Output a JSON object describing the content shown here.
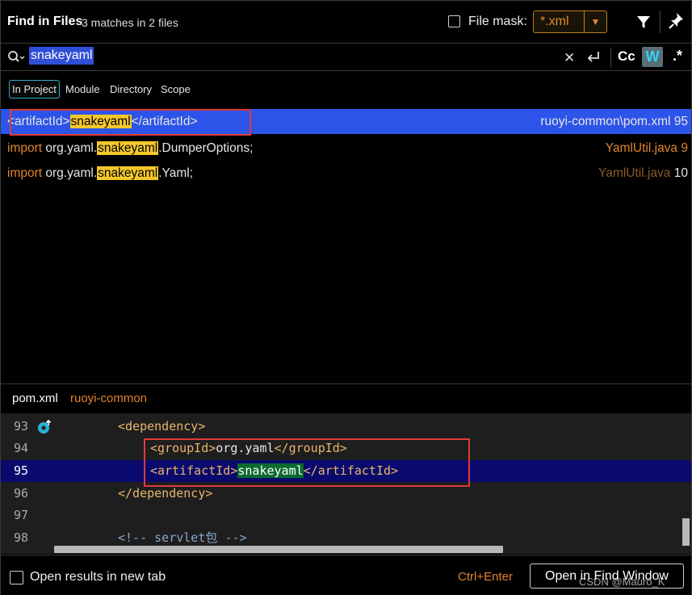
{
  "header": {
    "title": "Find in Files",
    "match_count": "3 matches in 2 files",
    "file_mask_label": "File mask:",
    "file_mask_value": "*.xml"
  },
  "search": {
    "query": "snakeyaml",
    "cc_label": "Cc",
    "words_label": "W",
    "regex_label": ".*"
  },
  "scope": {
    "tabs": [
      "In Project",
      "Module",
      "Directory",
      "Scope"
    ],
    "active": "In Project"
  },
  "results": [
    {
      "prefix": "<artifactId>",
      "match": "snakeyaml",
      "suffix": "</artifactId>",
      "location": "ruoyi-common\\pom.xml 95"
    },
    {
      "keyword": "import",
      "prefix": " org.yaml.",
      "match": "snakeyaml",
      "suffix": ".DumperOptions;",
      "file": "YamlUtil.java",
      "line": "9"
    },
    {
      "keyword": "import",
      "prefix": " org.yaml.",
      "match": "snakeyaml",
      "suffix": ".Yaml;",
      "file": "YamlUtil.java",
      "line": "10"
    }
  ],
  "preview": {
    "file": "pom.xml",
    "module": "ruoyi-common",
    "lines": [
      {
        "num": "93",
        "open": "<dependency>"
      },
      {
        "num": "94",
        "open": "<groupId>",
        "text": "org.yaml",
        "close": "</groupId>"
      },
      {
        "num": "95",
        "open": "<artifactId>",
        "text": "snakeyaml",
        "close": "</artifactId>"
      },
      {
        "num": "96",
        "open": "</dependency>"
      },
      {
        "num": "97"
      },
      {
        "num": "98",
        "comment": "<!-- servlet包 -->"
      }
    ]
  },
  "footer": {
    "new_tab_label": "Open results in new tab",
    "shortcut": "Ctrl+Enter",
    "open_button": "Open in Find Window",
    "watermark": "CSDN @Mauro_K"
  },
  "colors": {
    "accent_selection": "#2d54e8",
    "match_highlight": "#f4c82a",
    "keyword": "#e0832f",
    "annotation_box": "#e03a3a"
  }
}
